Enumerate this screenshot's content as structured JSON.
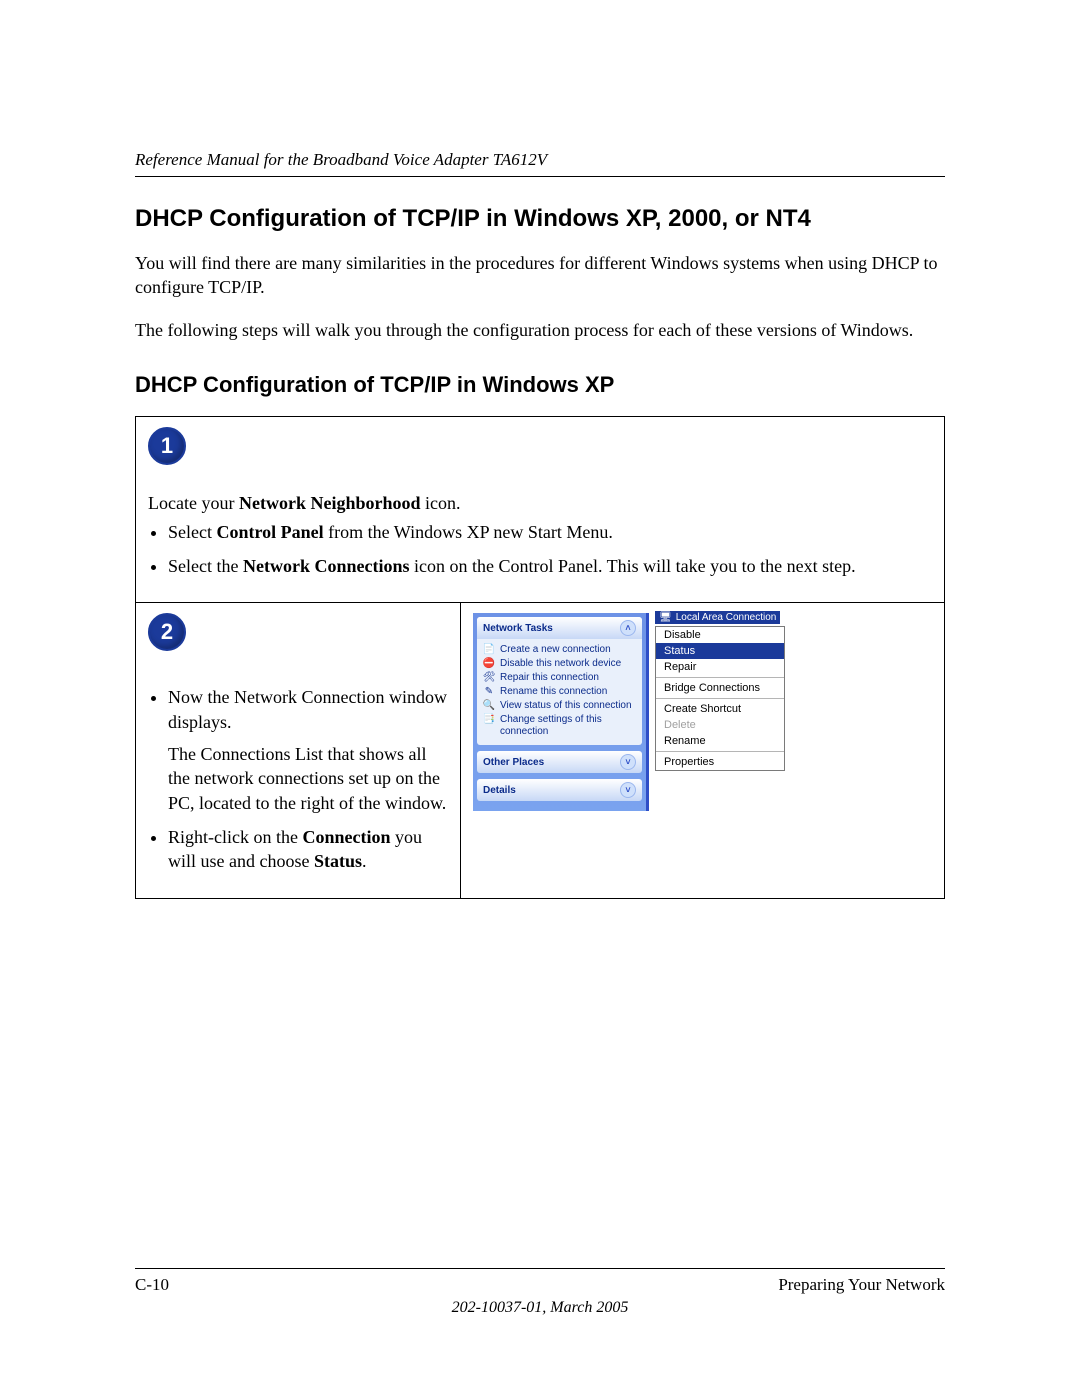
{
  "header": {
    "running_title": "Reference Manual for the Broadband Voice Adapter TA612V"
  },
  "headings": {
    "h_main": "DHCP Configuration of TCP/IP in Windows XP, 2000, or NT4",
    "h_sub": "DHCP Configuration of TCP/IP in Windows XP"
  },
  "paragraphs": {
    "p1": "You will find there are many similarities in the procedures for different Windows systems when using DHCP to configure TCP/IP.",
    "p2": "The following steps will walk you through the configuration process for each of these versions of Windows."
  },
  "steps": [
    {
      "num": "1",
      "intro_pre": "Locate your ",
      "intro_bold": "Network Neighborhood",
      "intro_post": " icon.",
      "bullets": [
        {
          "pre": "Select ",
          "b1": "Control Panel",
          "post": " from the Windows XP new Start Menu."
        },
        {
          "pre": "Select the ",
          "b1": "Network Connections",
          "post": " icon on the Control Panel.  This will take you to the next step."
        }
      ]
    },
    {
      "num": "2",
      "left_bullets": [
        {
          "text": "Now the Network Connection window displays."
        },
        {
          "text": "The Connections List that shows all the network connections set up on the PC, located to the right of the window.",
          "indent": true
        },
        {
          "pre": "Right-click on the ",
          "b1": "Connection",
          "mid": " you will use and choose ",
          "b2": "Status",
          "post": "."
        }
      ]
    }
  ],
  "xp_shot": {
    "conn_icon_label": "Local Area Connection",
    "task_header": "Network Tasks",
    "tasks": [
      {
        "icon": "new",
        "label": "Create a new connection"
      },
      {
        "icon": "disable",
        "label": "Disable this network device"
      },
      {
        "icon": "repair",
        "label": "Repair this connection"
      },
      {
        "icon": "rename",
        "label": "Rename this connection"
      },
      {
        "icon": "status",
        "label": "View status of this connection"
      },
      {
        "icon": "settings",
        "label": "Change settings of this connection"
      }
    ],
    "other_places": "Other Places",
    "details": "Details",
    "context_menu": [
      {
        "label": "Disable"
      },
      {
        "label": "Status",
        "highlight": true
      },
      {
        "label": "Repair"
      },
      {
        "sep": true
      },
      {
        "label": "Bridge Connections"
      },
      {
        "sep": true
      },
      {
        "label": "Create Shortcut"
      },
      {
        "label": "Delete",
        "disabled": true
      },
      {
        "label": "Rename"
      },
      {
        "sep": true
      },
      {
        "label": "Properties"
      }
    ]
  },
  "footer": {
    "page_num": "C-10",
    "section": "Preparing Your Network",
    "doc_info": "202-10037-01, March 2005"
  }
}
